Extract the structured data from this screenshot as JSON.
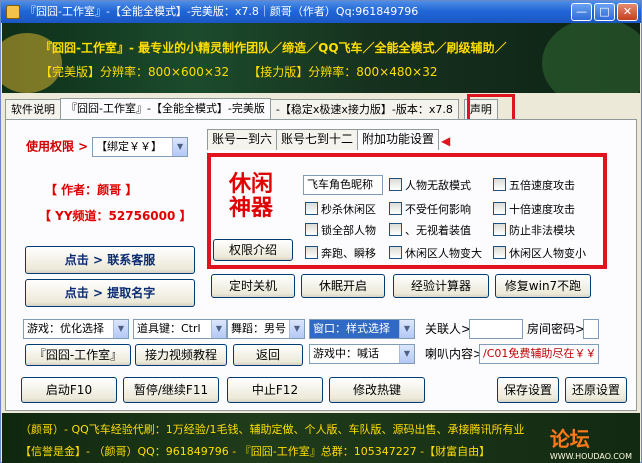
{
  "window": {
    "title": "『囧囧-工作室』-【全能全模式】-完美版：x7.8｜颜哥（作者）Qq:961849796",
    "min_label": "—",
    "max_label": "□",
    "close_label": "✕"
  },
  "banner": {
    "line1": "『囧囧-工作室』- 最专业的小精灵制作团队／缔造／QQ飞车／全能全模式／刷级辅助／",
    "line2_a": "【完美版】分辨率：800×600×32",
    "line2_b": "【接力版】分辨率：800×480×32"
  },
  "tabs": [
    {
      "label": "软件说明"
    },
    {
      "label": "『囧囧-工作室』-【全能全模式】-完美版"
    },
    {
      "label": "-【稳定x极速x接力版】-版本："
    },
    {
      "label": "x7.8"
    },
    {
      "label": "声明"
    }
  ],
  "left": {
    "perm_label": "使用权限 >",
    "perm_select": "【绑定￥￥】",
    "author": "【 作者：颜哥 】",
    "channel": "【 YY频道：52756000 】",
    "btn_contact": "点击 > 联系客服",
    "btn_getname": "点击 > 提取名字"
  },
  "subtabs": [
    {
      "label": "账号一到六"
    },
    {
      "label": "账号七到十二"
    },
    {
      "label": "附加功能设置"
    }
  ],
  "arrow_mark": "◀",
  "feature": {
    "title_1": "休闲",
    "title_2": "神器",
    "perm_intro": "权限介绍",
    "role_name": "飞车角色昵称",
    "checks": [
      {
        "label": "人物无敌模式"
      },
      {
        "label": "五倍速度攻击"
      },
      {
        "label": "秒杀休闲区"
      },
      {
        "label": "不受任何影响"
      },
      {
        "label": "十倍速度攻击"
      },
      {
        "label": "锁全部人物"
      },
      {
        "label": "、无视着装值"
      },
      {
        "label": "防止非法模块"
      },
      {
        "label": "奔跑、瞬移"
      },
      {
        "label": "休闲区人物变大"
      },
      {
        "label": "休闲区人物变小"
      }
    ]
  },
  "action_buttons": [
    "定时关机",
    "休眠开启",
    "经验计算器",
    "修复win7不跑"
  ],
  "row1": {
    "game_select": "游戏：优化选择",
    "prop_select": "道具键：Ctrl",
    "dance_select": "舞蹈：男号",
    "window_select": "窗口：样式选择",
    "contact_label": "关联人>",
    "room_pwd_label": "房间密码>"
  },
  "row2": {
    "studio_btn": "『囧囧-工作室』",
    "video_btn": "接力视频教程",
    "back_btn": "返回",
    "ingame_select": "游戏中：喊话",
    "horn_label": "喇叭内容>",
    "horn_value": "/C01免费辅助尽在￥￥"
  },
  "bottom_buttons": {
    "start": "启动F10",
    "pause": "暂停/继续F11",
    "stop": "中止F12",
    "hotkey": "修改热键",
    "save": "保存设置",
    "restore": "还原设置"
  },
  "footer": {
    "line1": "（颜哥）- QQ飞车经验代刷：1万经验/1毛钱、辅助定做、个人版、车队版、源码出售、承接腾讯所有业",
    "line2": "【信誉是金】- （颜哥）QQ：961849796 - 『囧囧-工作室』总群：105347227 -【财富自由】",
    "watermark": "论坛",
    "watermark_url": "WWW.HOUDAO.COM"
  }
}
